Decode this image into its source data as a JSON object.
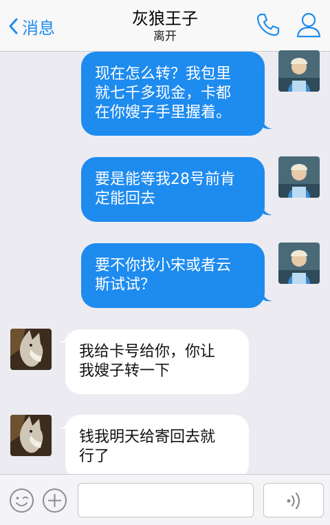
{
  "header": {
    "back_label": "消息",
    "title": "灰狼王子",
    "status": "离开"
  },
  "icons": {
    "back": "chevron-left-icon",
    "phone": "phone-icon",
    "profile": "person-icon",
    "emoji": "smiley-icon",
    "plus": "plus-icon",
    "voice": "voice-wave-icon"
  },
  "colors": {
    "accent": "#1e8bef",
    "outgoing_bubble": "#1e8bef",
    "incoming_bubble": "#ffffff",
    "background": "#ebebf1"
  },
  "messages": [
    {
      "direction": "out",
      "text": "现在怎么转？我包里\n就七千多现金，卡都\n在你嫂子手里握着。"
    },
    {
      "direction": "out",
      "text": "要是能等我28号前肯\n定能回去"
    },
    {
      "direction": "out",
      "text": "要不你找小宋或者云\n斯试试？"
    },
    {
      "direction": "in",
      "text": "我给卡号给你，你让\n我嫂子转一下"
    },
    {
      "direction": "in",
      "text": "钱我明天给寄回去就\n行了"
    }
  ],
  "composer": {
    "input_value": "",
    "input_placeholder": ""
  }
}
